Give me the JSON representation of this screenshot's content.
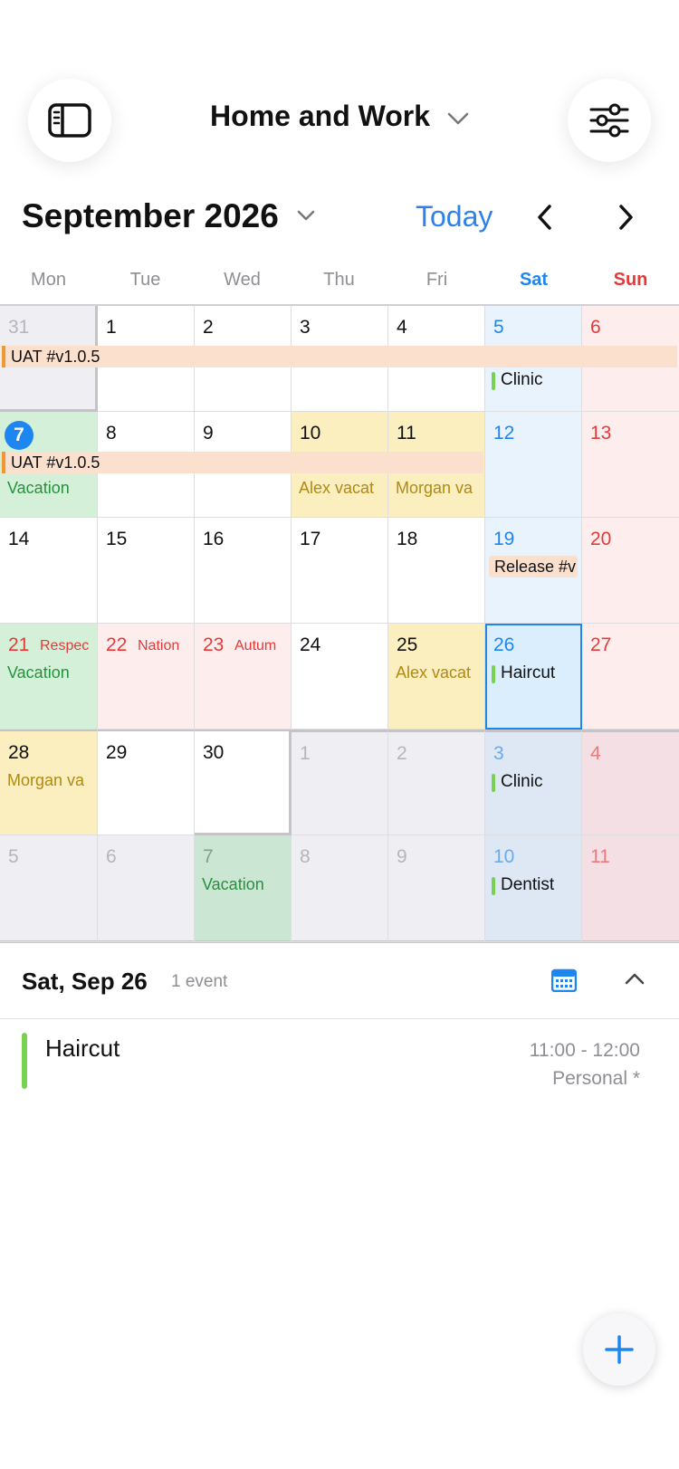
{
  "header": {
    "title": "Home and Work",
    "sidebar_icon": "sidebar-icon",
    "filter_icon": "sliders-icon"
  },
  "month": {
    "title": "September 2026",
    "today_label": "Today"
  },
  "weekdays": [
    "Mon",
    "Tue",
    "Wed",
    "Thu",
    "Fri",
    "Sat",
    "Sun"
  ],
  "weeks": [
    [
      "31",
      "1",
      "2",
      "3",
      "4",
      "5",
      "6"
    ],
    [
      "7",
      "8",
      "9",
      "10",
      "11",
      "12",
      "13"
    ],
    [
      "14",
      "15",
      "16",
      "17",
      "18",
      "19",
      "20"
    ],
    [
      "21",
      "22",
      "23",
      "24",
      "25",
      "26",
      "27"
    ],
    [
      "28",
      "29",
      "30",
      "1",
      "2",
      "3",
      "4"
    ],
    [
      "5",
      "6",
      "7",
      "8",
      "9",
      "10",
      "11"
    ]
  ],
  "events": {
    "uat_label": "UAT #v1.0.5",
    "clinic": "Clinic",
    "vacation": "Vacation",
    "alex_vacation": "Alex vacat",
    "morgan_vacation": "Morgan va",
    "release": "Release #v",
    "respect": "Respec",
    "national": "Nation",
    "autumn": "Autum",
    "haircut": "Haircut",
    "dentist": "Dentist"
  },
  "agenda": {
    "date": "Sat, Sep 26",
    "count": "1 event",
    "items": [
      {
        "title": "Haircut",
        "time": "11:00 - 12:00",
        "calendar": "Personal *"
      }
    ]
  },
  "colors": {
    "accent": "#1d86f0",
    "sunday": "#e63a3a",
    "vacation_green": "#d4f0d9",
    "vacation_yellow": "#fbefbf",
    "event_bar": "#79d152"
  }
}
